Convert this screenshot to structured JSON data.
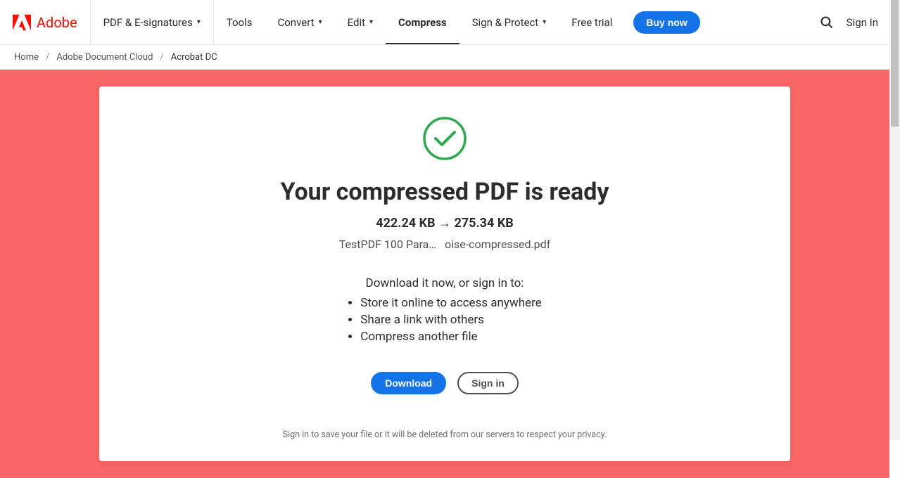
{
  "header": {
    "brand": "Adobe",
    "nav": {
      "pdf_esign": "PDF & E-signatures",
      "tools": "Tools",
      "convert": "Convert",
      "edit": "Edit",
      "compress": "Compress",
      "sign_protect": "Sign & Protect",
      "free_trial": "Free trial"
    },
    "buy_now": "Buy now",
    "sign_in": "Sign In"
  },
  "breadcrumb": {
    "home": "Home",
    "doc_cloud": "Adobe Document Cloud",
    "current": "Acrobat DC"
  },
  "card": {
    "title": "Your compressed PDF is ready",
    "size_from": "422.24 KB",
    "size_arrow": "→",
    "size_to": "275.34 KB",
    "filename_left": "TestPDF 100 Para…",
    "filename_right": "oise-compressed.pdf",
    "prompt": "Download it now, or sign in to:",
    "benefits": [
      "Store it online to access anywhere",
      "Share a link with others",
      "Compress another file"
    ],
    "download_btn": "Download",
    "signin_btn": "Sign in",
    "footer": "Sign in to save your file or it will be deleted from our servers to respect your privacy."
  }
}
